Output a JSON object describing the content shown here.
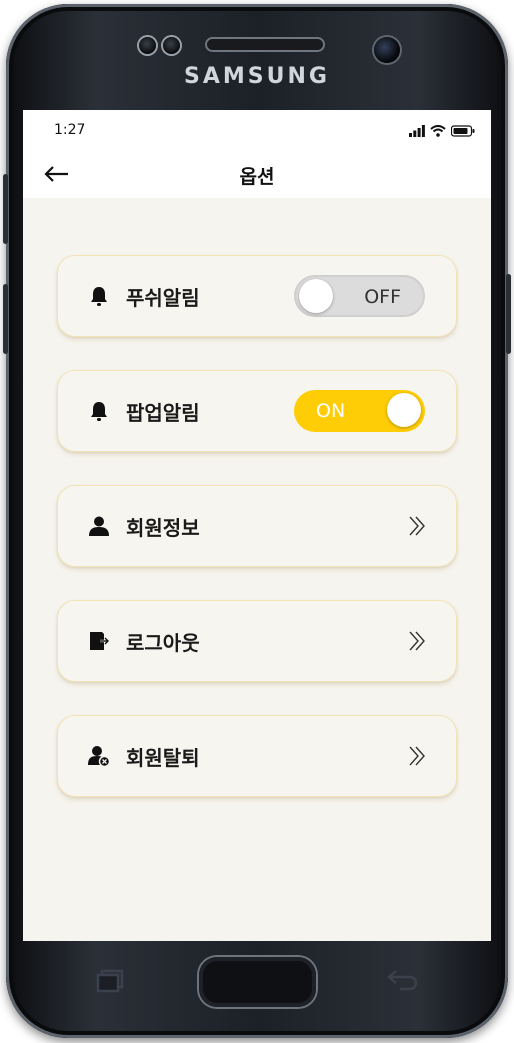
{
  "device": {
    "brand": "SAMSUNG"
  },
  "status_bar": {
    "time": "1:27"
  },
  "header": {
    "title": "옵션"
  },
  "menu": {
    "push": {
      "label": "푸쉬알림",
      "icon": "bell-icon",
      "toggle_state": "OFF"
    },
    "popup": {
      "label": "팝업알림",
      "icon": "bell-icon",
      "toggle_state": "ON"
    },
    "member_info": {
      "label": "회원정보",
      "icon": "user-icon"
    },
    "logout": {
      "label": "로그아웃",
      "icon": "logout-icon"
    },
    "withdraw": {
      "label": "회원탈퇴",
      "icon": "user-remove-icon"
    }
  },
  "colors": {
    "accent": "#ffcd05",
    "screen_bg": "#f6f4ef",
    "card_border": "#f1e3b6"
  }
}
